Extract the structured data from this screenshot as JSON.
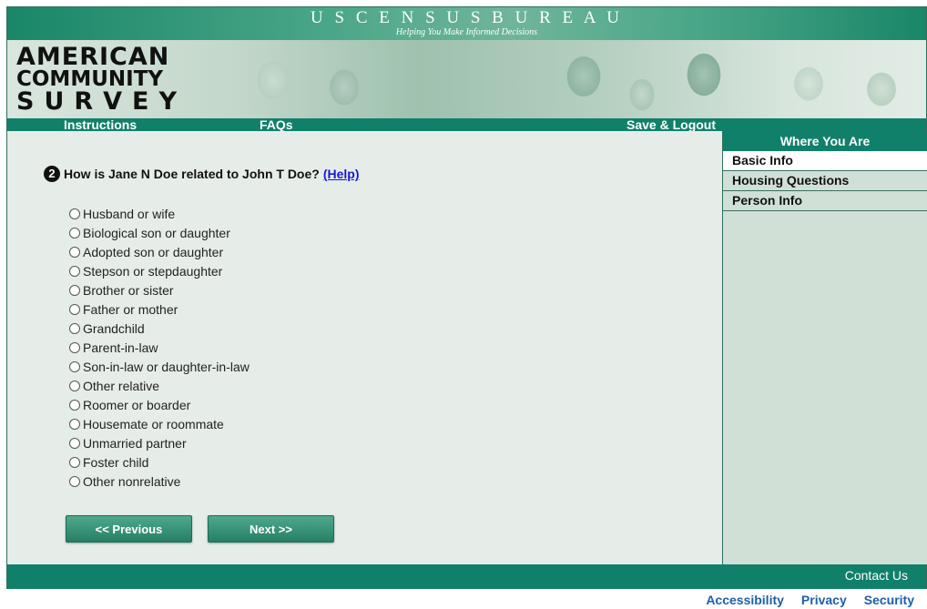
{
  "header": {
    "bureau": "U S C E N S U S B U R E A U",
    "tagline": "Helping You Make Informed Decisions",
    "logo_lines": [
      "AMERICAN",
      "COMMUNITY",
      "SURVEY"
    ]
  },
  "nav": {
    "instructions": "Instructions",
    "faqs": "FAQs",
    "save_logout": "Save & Logout"
  },
  "question": {
    "number": "2",
    "text": "How is Jane N Doe related to John T Doe?",
    "help": "(Help)"
  },
  "options": [
    "Husband or wife",
    "Biological son or daughter",
    "Adopted son or daughter",
    "Stepson or stepdaughter",
    "Brother or sister",
    "Father or mother",
    "Grandchild",
    "Parent-in-law",
    "Son-in-law or daughter-in-law",
    "Other relative",
    "Roomer or boarder",
    "Housemate or roommate",
    "Unmarried partner",
    "Foster child",
    "Other nonrelative"
  ],
  "buttons": {
    "previous": "<<   Previous",
    "next": "Next   >>"
  },
  "sidebar": {
    "title": "Where You Are",
    "items": [
      "Basic Info",
      "Housing Questions",
      "Person Info"
    ],
    "active_index": 0
  },
  "footer": {
    "contact": "Contact Us",
    "links": [
      "Accessibility",
      "Privacy",
      "Security"
    ]
  },
  "colors": {
    "brand_green": "#11806a",
    "link_blue": "#1a1acc",
    "footer_link": "#1d5fa8"
  }
}
